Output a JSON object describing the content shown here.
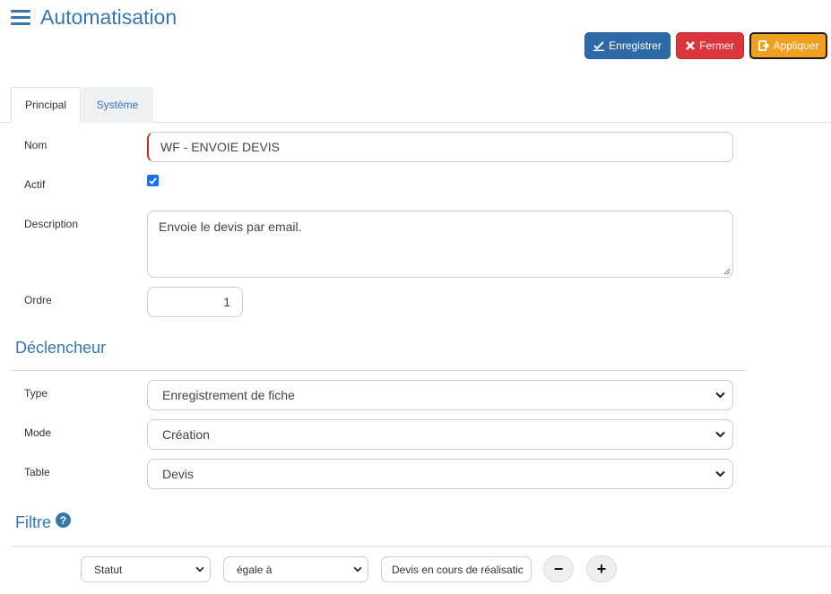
{
  "header": {
    "title": "Automatisation"
  },
  "toolbar": {
    "save_label": "Enregistrer",
    "close_label": "Fermer",
    "apply_label": "Appliquer"
  },
  "tabs": [
    {
      "label": "Principal",
      "active": true
    },
    {
      "label": "Système",
      "active": false
    }
  ],
  "form": {
    "nom": {
      "label": "Nom",
      "value": "WF - ENVOIE DEVIS"
    },
    "actif": {
      "label": "Actif",
      "checked": true
    },
    "description": {
      "label": "Description",
      "value": "Envoie le devis par email."
    },
    "ordre": {
      "label": "Ordre",
      "value": "1"
    }
  },
  "trigger": {
    "title": "Déclencheur",
    "type": {
      "label": "Type",
      "value": "Enregistrement de fiche"
    },
    "mode": {
      "label": "Mode",
      "value": "Création"
    },
    "table": {
      "label": "Table",
      "value": "Devis"
    }
  },
  "filter": {
    "title": "Filtre",
    "field": "Statut",
    "operator": "égale à",
    "value": "Devis en cours de réalisatic",
    "remove_label": "−",
    "add_label": "+"
  },
  "colors": {
    "accent": "#3776b1",
    "save": "#2e6aa8",
    "close": "#d9363e",
    "apply": "#f0a020",
    "required": "#c62828"
  }
}
